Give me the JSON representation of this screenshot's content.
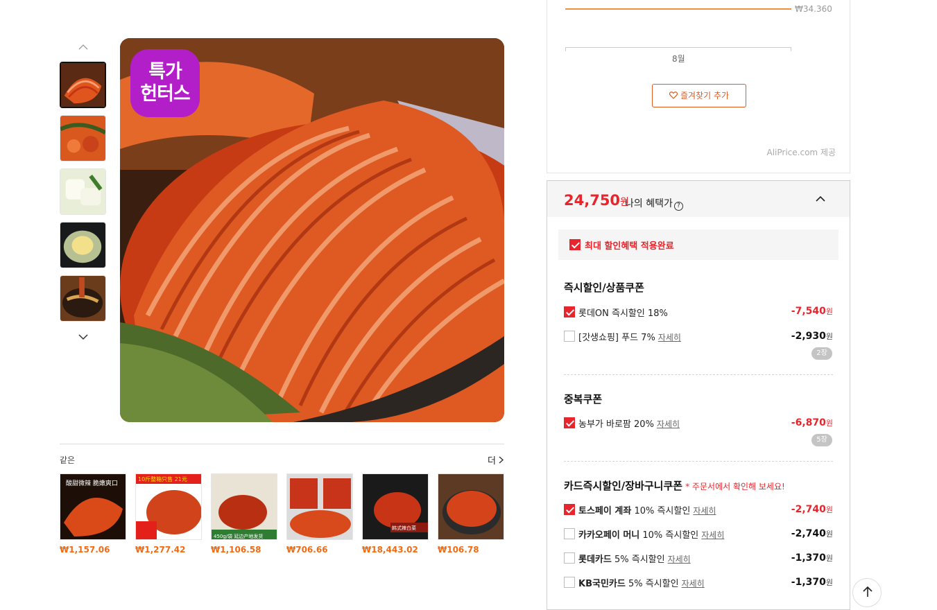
{
  "gallery": {
    "thumbnails": [
      "kimchi-cabbage",
      "kimchi-radish-greens",
      "white-kimchi",
      "cabbage-bowl",
      "kimchi-noodle-dish"
    ],
    "badge_line1": "특가",
    "badge_line2": "헌터스"
  },
  "related": {
    "title": "같은",
    "more_label": "더",
    "items": [
      {
        "price": "₩1,157.06",
        "image_text": "酸甜微辣 脆嫩爽口"
      },
      {
        "price": "₩1,277.42",
        "image_text": "10斤整箱只售 21元"
      },
      {
        "price": "₩1,106.58",
        "image_text": "450g/袋 延边产地发货"
      },
      {
        "price": "₩706.66",
        "image_text": ""
      },
      {
        "price": "₩18,443.02",
        "image_text": "韩式辣白菜"
      },
      {
        "price": "₩106.78",
        "image_text": ""
      }
    ]
  },
  "price_history": {
    "value_label": "₩34.360",
    "month_label": "8월",
    "favorite_button": "즐겨찾기 추가",
    "provider": "AliPrice.com 제공"
  },
  "benefits": {
    "price": "24,750",
    "currency": "원",
    "label": "나의 혜택가",
    "max_applied": "최대 할인혜택 적용완료",
    "instant_section": "즉시할인/상품쿠폰",
    "instant": [
      {
        "label": "롯데ON 즉시할인 18%",
        "amount": "-7,540",
        "unit": "원",
        "checked": true
      },
      {
        "label": "[갓생쇼핑] 푸드 7%",
        "detail": "자세히",
        "amount": "-2,930",
        "unit": "원",
        "checked": false,
        "count": "2장"
      }
    ],
    "dup_section": "중복쿠폰",
    "dup": [
      {
        "label": "농부가 바로팜 20%",
        "detail": "자세히",
        "amount": "-6,870",
        "unit": "원",
        "checked": true,
        "count": "5장"
      }
    ],
    "card_section": "카드즉시할인/장바구니쿠폰",
    "card_note": "* 주문서에서 확인해 보세요!",
    "cards": [
      {
        "brand": "토스페이 계좌",
        "label": "10% 즉시할인",
        "detail": "자세히",
        "amount": "-2,740",
        "unit": "원",
        "checked": true
      },
      {
        "brand": "카카오페이 머니",
        "label": "10% 즉시할인",
        "detail": "자세히",
        "amount": "-2,740",
        "unit": "원",
        "checked": false
      },
      {
        "brand": "롯데카드",
        "label": "5% 즉시할인",
        "detail": "자세히",
        "amount": "-1,370",
        "unit": "원",
        "checked": false
      },
      {
        "brand": "KB국민카드",
        "label": "5% 즉시할인",
        "detail": "자세히",
        "amount": "-1,370",
        "unit": "원",
        "checked": false
      }
    ]
  },
  "colors": {
    "accent": "#e8252c",
    "orange": "#f26a12",
    "badge": "#b21ec8"
  }
}
